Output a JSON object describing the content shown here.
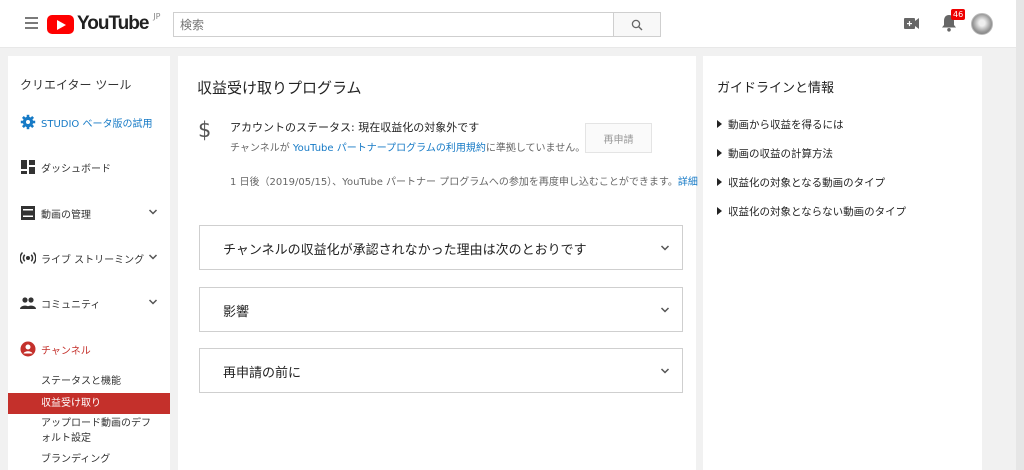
{
  "header": {
    "logo_text": "YouTube",
    "logo_region": "JP",
    "search_placeholder": "検索",
    "notification_count": "46"
  },
  "sidebar": {
    "title": "クリエイター ツール",
    "items": [
      {
        "label": "STUDIO ベータ版の試用",
        "icon": "gear-icon"
      },
      {
        "label": "ダッシュボード",
        "icon": "dashboard-icon"
      },
      {
        "label": "動画の管理",
        "icon": "video-manager-icon"
      },
      {
        "label": "ライブ ストリーミング",
        "icon": "live-icon"
      },
      {
        "label": "コミュニティ",
        "icon": "community-icon"
      },
      {
        "label": "チャンネル",
        "icon": "account-icon"
      }
    ],
    "channel_subitems": [
      {
        "label": "ステータスと機能"
      },
      {
        "label": "収益受け取り"
      },
      {
        "label": "アップロード動画のデフォルト設定"
      },
      {
        "label": "ブランディング"
      }
    ]
  },
  "main": {
    "title": "収益受け取りプログラム",
    "status_label": "アカウントのステータス: 現在収益化の対象外です",
    "status_desc_prefix": "チャンネルが ",
    "status_desc_link": "YouTube パートナープログラムの利用規約",
    "status_desc_suffix": "に準拠していません。",
    "reapply_label": "再申請",
    "notice_text": "1 日後（2019/05/15）、YouTube パートナー プログラムへの参加を再度申し込むことができます。",
    "notice_link": "詳細",
    "accordions": [
      {
        "label": "チャンネルの収益化が承認されなかった理由は次のとおりです"
      },
      {
        "label": "影響"
      },
      {
        "label": "再申請の前に"
      }
    ]
  },
  "right": {
    "title": "ガイドラインと情報",
    "links": [
      {
        "label": "動画から収益を得るには"
      },
      {
        "label": "動画の収益の計算方法"
      },
      {
        "label": "収益化の対象となる動画のタイプ"
      },
      {
        "label": "収益化の対象とならない動画のタイプ"
      }
    ]
  },
  "colors": {
    "brand_red": "#ff0000",
    "active_item": "#c4302b",
    "link": "#167ac6"
  }
}
